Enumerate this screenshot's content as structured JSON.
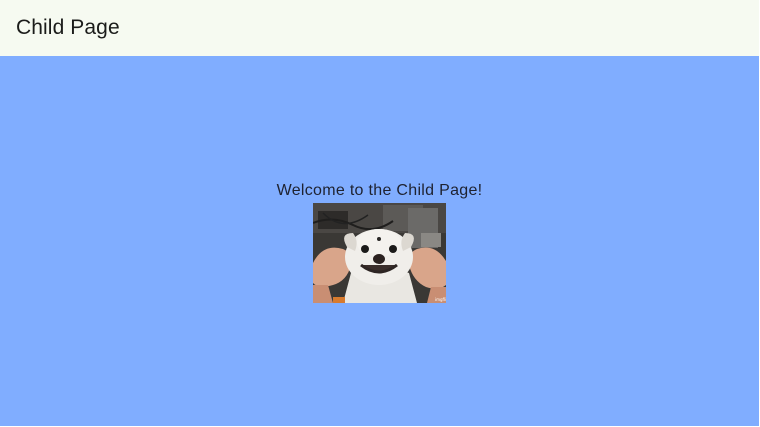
{
  "app_bar": {
    "title": "Child Page"
  },
  "content": {
    "welcome_text": "Welcome to the Child Page!",
    "image": {
      "description_icon": "dog-photo",
      "watermark": "imgflip"
    }
  },
  "colors": {
    "app_bar_background": "#f6faf1",
    "body_background": "#80adff",
    "title_text": "#1b1c1a",
    "body_text": "#1e2230"
  }
}
